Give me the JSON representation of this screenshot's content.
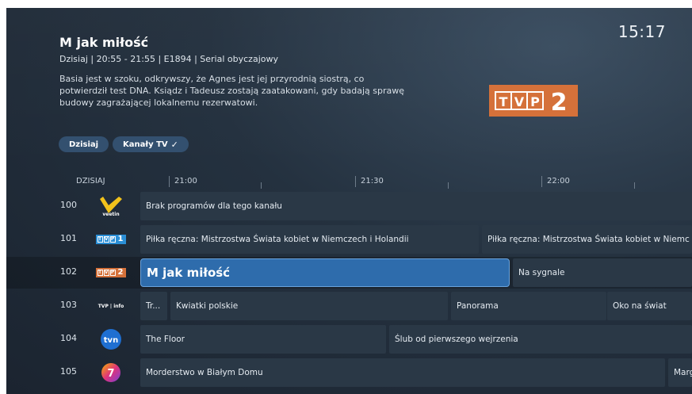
{
  "header": {
    "clock": "15:17",
    "program_title": "M jak miłość",
    "program_meta": "Dzisiaj | 20:55 - 21:55 | E1894 | Serial obyczajowy",
    "program_description": "Basia jest w szoku, odkrywszy, że Agnes jest jej przyrodnią siostrą, co potwierdził test DNA. Ksiądz i Tadeusz zostają zaatakowani, gdy badają sprawę budowy zagrażającej lokalnemu rezerwatowi.",
    "channel_logo": {
      "letters": [
        "T",
        "V",
        "P"
      ],
      "number": "2",
      "color": "#d5713a"
    }
  },
  "filters": {
    "today": "Dzisiaj",
    "channels": "Kanały TV",
    "channels_check": "✓"
  },
  "timeline": {
    "day": "DZISIAJ",
    "times": [
      "21:00",
      "21:30",
      "22:00"
    ]
  },
  "channels": [
    {
      "number": "100",
      "logo": "veeting-logo",
      "logo_text": "veetin",
      "programs": [
        {
          "title": "Brak programów dla tego kanału"
        }
      ]
    },
    {
      "number": "101",
      "logo": "tvp1-logo",
      "logo_letters": [
        "T",
        "V",
        "P"
      ],
      "logo_number": "1",
      "programs": [
        {
          "title": "Piłka ręczna: Mistrzostwa Świata kobiet w Niemczech i Holandii"
        },
        {
          "title": "Piłka ręczna: Mistrzostwa Świata kobiet w Niemc"
        }
      ]
    },
    {
      "number": "102",
      "logo": "tvp2-logo",
      "logo_letters": [
        "T",
        "V",
        "P"
      ],
      "logo_number": "2",
      "programs": [
        {
          "title": "M jak miłość",
          "selected": true
        },
        {
          "title": "Na sygnale"
        }
      ]
    },
    {
      "number": "103",
      "logo": "tvp-info-logo",
      "logo_text": "TVP | info",
      "programs": [
        {
          "title": "Tr..."
        },
        {
          "title": "Kwiatki polskie"
        },
        {
          "title": "Panorama"
        },
        {
          "title": "Oko na świat"
        }
      ]
    },
    {
      "number": "104",
      "logo": "tvn-logo",
      "logo_text": "tvn",
      "programs": [
        {
          "title": "The Floor"
        },
        {
          "title": "Ślub od pierwszego wejrzenia"
        }
      ]
    },
    {
      "number": "105",
      "logo": "tv7-logo",
      "logo_text": "7",
      "programs": [
        {
          "title": "Morderstwo w Białym Domu"
        },
        {
          "title": "Marg"
        }
      ]
    }
  ],
  "colors": {
    "selected": "#2e6cac",
    "cell": "#2a3846",
    "chip": "#33506f",
    "tvp_orange": "#d5713a",
    "tvp1_blue": "#2b8fd6",
    "veeting_yellow": "#f2c21b",
    "tvn_blue": "#1f6fd1"
  }
}
